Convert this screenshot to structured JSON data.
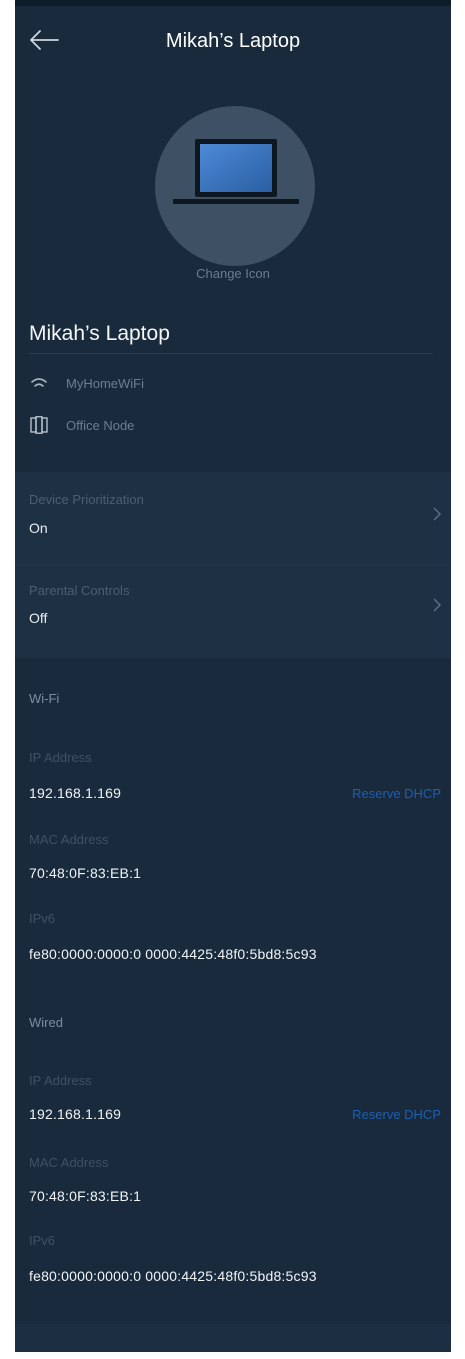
{
  "header": {
    "title": "Mikah’s Laptop",
    "back_icon": "back-arrow-icon"
  },
  "avatar": {
    "icon": "laptop-icon",
    "change_label": "Change Icon"
  },
  "device": {
    "name": "Mikah’s Laptop",
    "network": {
      "icon": "wifi-icon",
      "label": "MyHomeWiFi"
    },
    "node": {
      "icon": "node-icon",
      "label": "Office Node"
    }
  },
  "settings": [
    {
      "label": "Device Prioritization",
      "value": "On"
    },
    {
      "label": "Parental Controls",
      "value": "Off"
    }
  ],
  "wifi": {
    "heading": "Wi-Fi",
    "ip_label": "IP Address",
    "ip": "192.168.1.169",
    "reserve": "Reserve DHCP",
    "mac_label": "MAC Address",
    "mac": "70:48:0F:83:EB:1",
    "ipv6_label": "IPv6",
    "ipv6": "fe80:0000:0000:0 0000:4425:48f0:5bd8:5c93"
  },
  "wired": {
    "heading": "Wired",
    "ip_label": "IP Address",
    "ip": "192.168.1.169",
    "reserve": "Reserve DHCP",
    "mac_label": "MAC Address",
    "mac": "70:48:0F:83:EB:1",
    "ipv6_label": "IPv6",
    "ipv6": "fe80:0000:0000:0 0000:4425:48f0:5bd8:5c93"
  },
  "colors": {
    "background": "#182a3c",
    "panel": "#1d3044",
    "link": "#1d5fb0",
    "avatar": "#3e5064",
    "screen": "#3a78c2"
  }
}
